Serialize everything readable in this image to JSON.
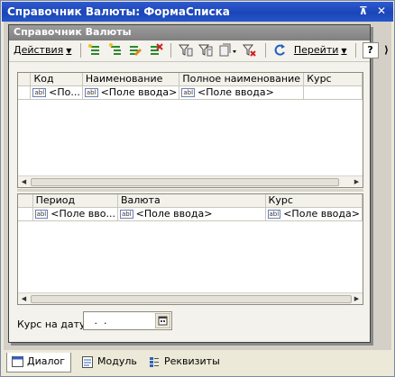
{
  "window": {
    "title": "Справочник Валюты: ФормаСписка",
    "pin_glyph": "⊼",
    "close_glyph": "✕"
  },
  "form": {
    "title": "Справочник Валюты"
  },
  "toolbar": {
    "actions_label": "Действия",
    "goto_label": "Перейти",
    "help_label": "?",
    "more_glyph": "⟩"
  },
  "currencies_table": {
    "columns": [
      "Код",
      "Наименование",
      "Полное наименование",
      "Курс"
    ],
    "rows": [
      [
        "<По...",
        "<Поле ввода>",
        "<Поле ввода>",
        ""
      ]
    ]
  },
  "rates_table": {
    "columns": [
      "Период",
      "Валюта",
      "Курс"
    ],
    "rows": [
      [
        "<Поле вво...",
        "<Поле ввода>",
        "<Поле ввода>"
      ]
    ]
  },
  "field_icon_text": "abl",
  "date_filter": {
    "label": "Курс на дату:",
    "value": " .  . "
  },
  "tabs": [
    {
      "label": "Диалог",
      "active": true
    },
    {
      "label": "Модуль",
      "active": false
    },
    {
      "label": "Реквизиты",
      "active": false
    }
  ]
}
